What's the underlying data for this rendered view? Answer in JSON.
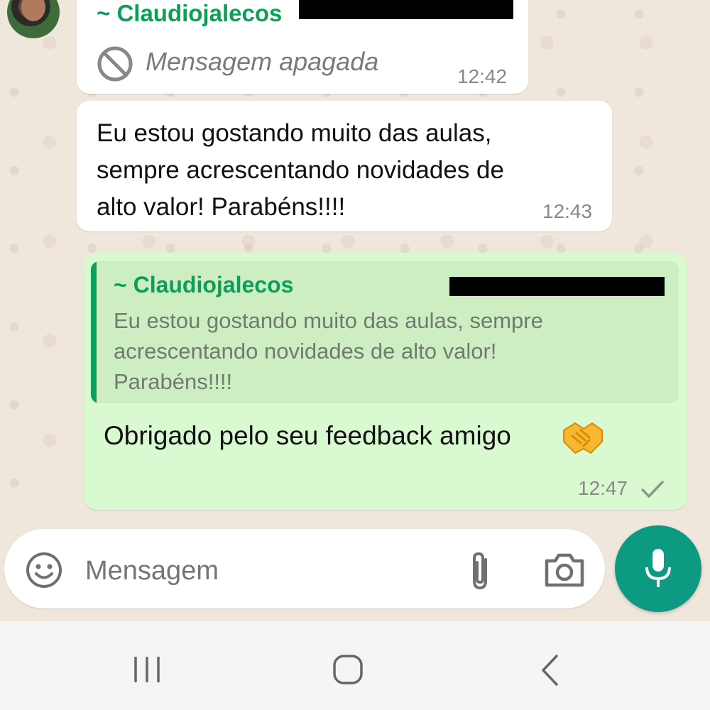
{
  "colors": {
    "sender_green": "#0aa05a",
    "incoming_bubble": "#ffffff",
    "outgoing_bubble": "#d9f9d0",
    "quote_bg": "#cdeec3",
    "mic_button": "#0d9a82"
  },
  "messages": {
    "deleted": {
      "sender": "~ Claudiojalecos",
      "text": "Mensagem apagada",
      "time": "12:42",
      "icon": "blocked-icon"
    },
    "feedback": {
      "lines": [
        "Eu estou gostando muito das aulas,",
        "sempre acrescentando novidades de",
        "alto valor! Parabéns!!!!"
      ],
      "time": "12:43"
    },
    "reply": {
      "quoted_sender": "~ Claudiojalecos",
      "quoted_lines": [
        "Eu estou gostando muito das aulas, sempre",
        "acrescentando novidades de alto valor!",
        "Parabéns!!!!"
      ],
      "text": "Obrigado pelo seu feedback amigo",
      "emoji": "handshake-emoji",
      "time": "12:47",
      "status_icon": "single-check-icon"
    }
  },
  "composer": {
    "placeholder": "Mensagem",
    "icons": [
      "emoji-icon",
      "attach-icon",
      "camera-icon",
      "mic-icon"
    ]
  },
  "navigation": {
    "icons": [
      "recent-apps-icon",
      "home-icon",
      "back-icon"
    ]
  }
}
